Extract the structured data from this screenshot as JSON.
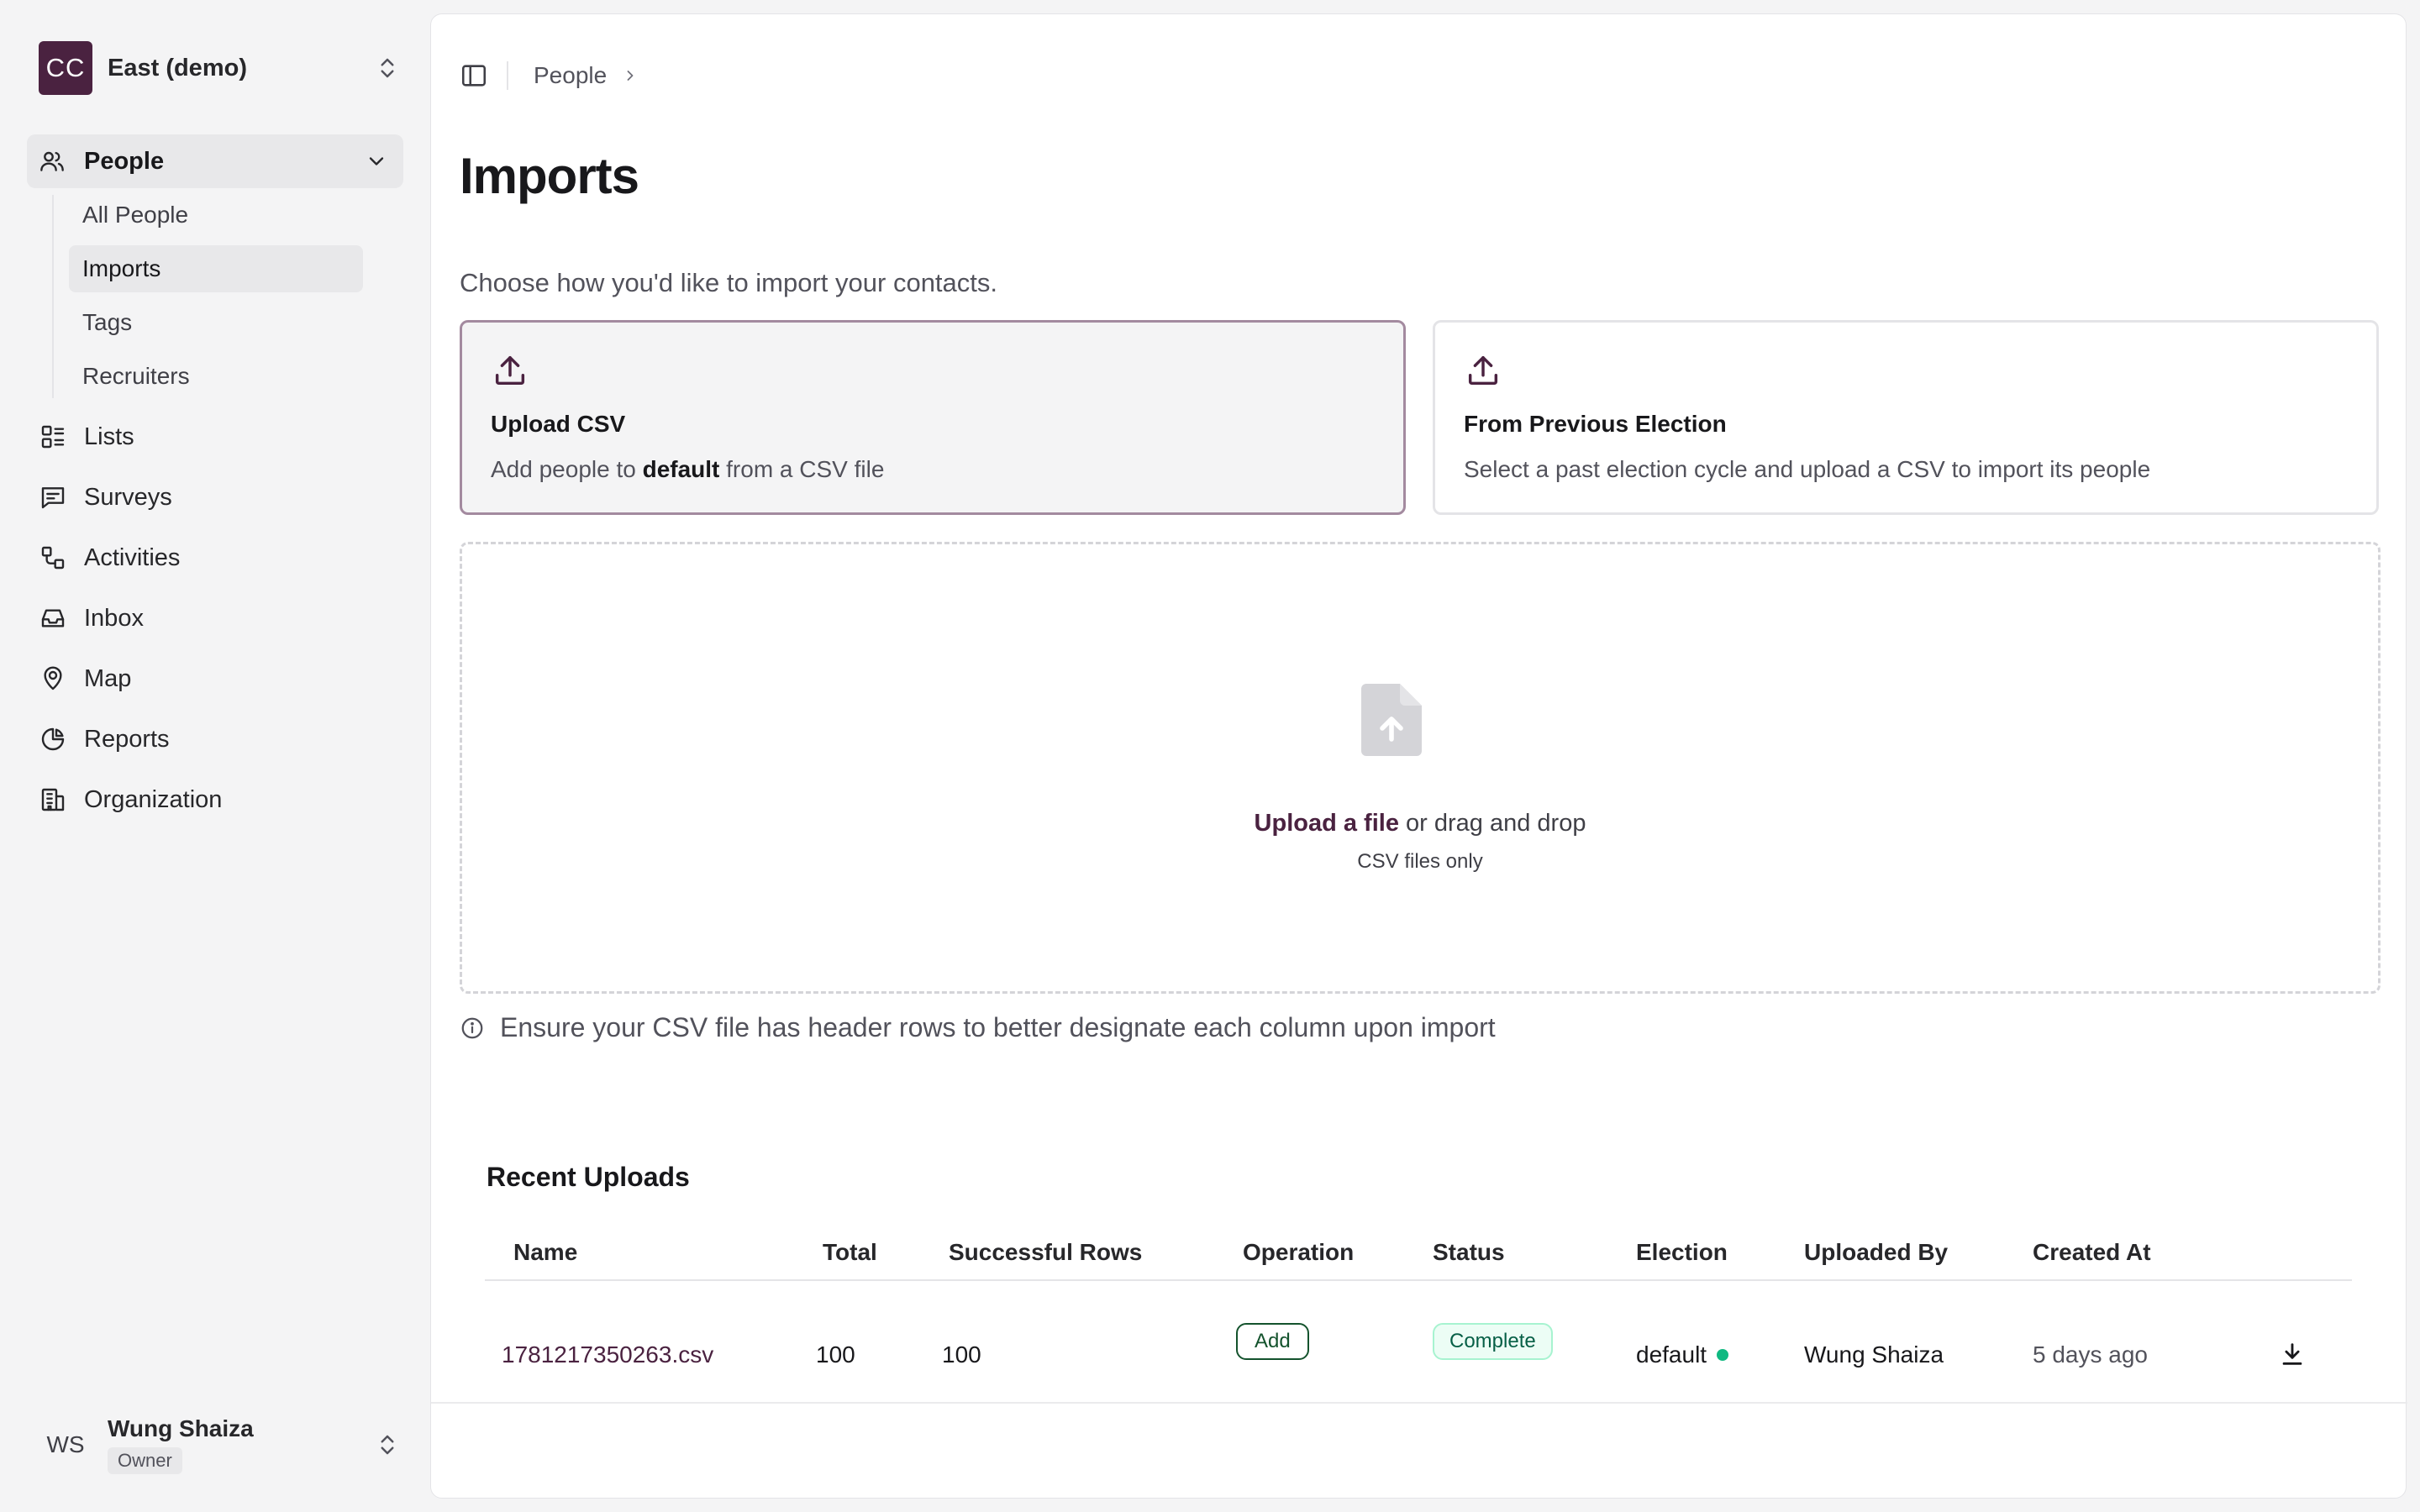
{
  "org": {
    "initials": "CC",
    "name": "East (demo)"
  },
  "nav": {
    "people": "People",
    "people_sub": [
      "All People",
      "Imports",
      "Tags",
      "Recruiters"
    ],
    "items": [
      "Lists",
      "Surveys",
      "Activities",
      "Inbox",
      "Map",
      "Reports",
      "Organization"
    ]
  },
  "user": {
    "initials": "WS",
    "name": "Wung Shaiza",
    "role": "Owner"
  },
  "breadcrumb": {
    "item": "People"
  },
  "page": {
    "title": "Imports",
    "subtitle": "Choose how you'd like to import your contacts."
  },
  "cards": {
    "upload": {
      "title": "Upload CSV",
      "desc_prefix": "Add people to ",
      "desc_bold": "default",
      "desc_suffix": " from a CSV file"
    },
    "previous": {
      "title": "From Previous Election",
      "desc": "Select a past election cycle and upload a CSV to import its people"
    }
  },
  "dropzone": {
    "link": "Upload a file",
    "text": " or drag and drop",
    "hint": "CSV files only"
  },
  "note": "Ensure your CSV file has header rows to better designate each column upon import",
  "recent": {
    "title": "Recent Uploads",
    "columns": [
      "Name",
      "Total",
      "Successful Rows",
      "Operation",
      "Status",
      "Election",
      "Uploaded By",
      "Created At"
    ],
    "rows": [
      {
        "name": "1781217350263.csv",
        "total": "100",
        "successful": "100",
        "operation": "Add",
        "status": "Complete",
        "election": "default",
        "uploaded_by": "Wung Shaiza",
        "created_at": "5 days ago"
      }
    ]
  },
  "colors": {
    "brand": "#4a2240",
    "success": "#10b981",
    "complete_bg": "#ecfdf5"
  }
}
